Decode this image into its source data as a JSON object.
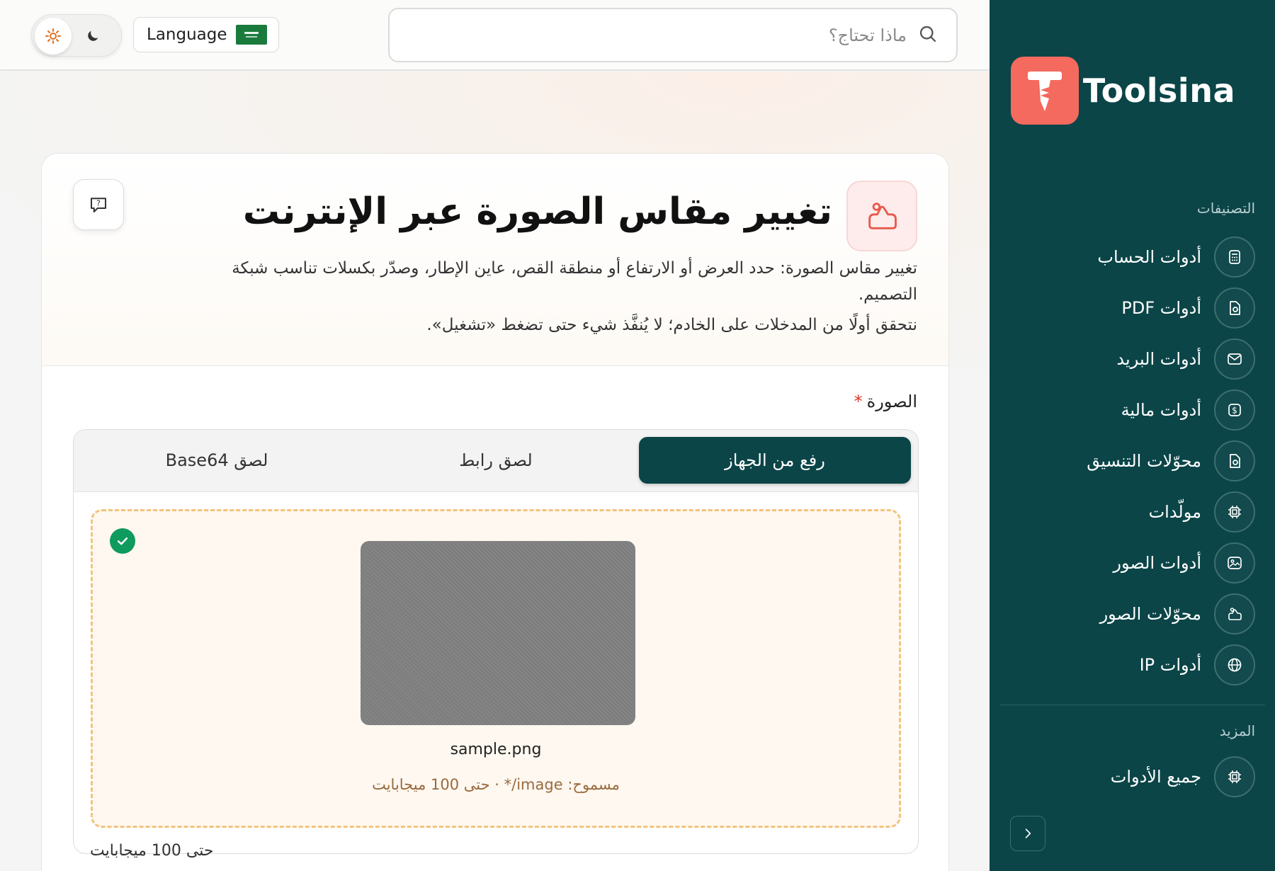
{
  "header": {
    "language_label": "Language",
    "search_placeholder": "ماذا تحتاج؟"
  },
  "brand": {
    "name": "Toolsina"
  },
  "sidebar": {
    "categories_heading": "التصنيفات",
    "items": [
      {
        "label": "أدوات الحساب",
        "icon": "calculator-icon"
      },
      {
        "label": "أدوات PDF",
        "icon": "document-icon"
      },
      {
        "label": "أدوات البريد",
        "icon": "mail-icon"
      },
      {
        "label": "أدوات مالية",
        "icon": "dollar-icon"
      },
      {
        "label": "محوّلات التنسيق",
        "icon": "convert-document-icon"
      },
      {
        "label": "مولّدات",
        "icon": "chip-icon"
      },
      {
        "label": "أدوات الصور",
        "icon": "image-icon"
      },
      {
        "label": "محوّلات الصور",
        "icon": "image-convert-icon"
      },
      {
        "label": "أدوات IP",
        "icon": "globe-icon"
      }
    ],
    "more_heading": "المزيد",
    "more_items": [
      {
        "label": "جميع الأدوات",
        "icon": "chip-icon"
      }
    ]
  },
  "tool": {
    "title": "تغيير مقاس الصورة عبر الإنترنت",
    "description_1": "تغيير مقاس الصورة: حدد العرض أو الارتفاع أو منطقة القص، عاين الإطار، وصدّر بكسلات تناسب شبكة التصميم.",
    "description_2": "نتحقق أولًا من المدخلات على الخادم؛ لا يُنفَّذ شيء حتى تضغط «تشغيل».",
    "field_label": "الصورة",
    "required_mark": "*",
    "tabs": [
      "رفع من الجهاز",
      "لصق رابط",
      "لصق Base64"
    ],
    "active_tab": 0,
    "file_name": "sample.png",
    "allowed_text": "مسموح: image/* · حتى 100 ميجابايت",
    "size_note": "حتى 100 ميجابايت"
  },
  "colors": {
    "sidebar_bg": "#0b4548",
    "brand_accent": "#f46a5e",
    "success": "#0f9a5e",
    "dropzone_border": "#f3c37d"
  }
}
